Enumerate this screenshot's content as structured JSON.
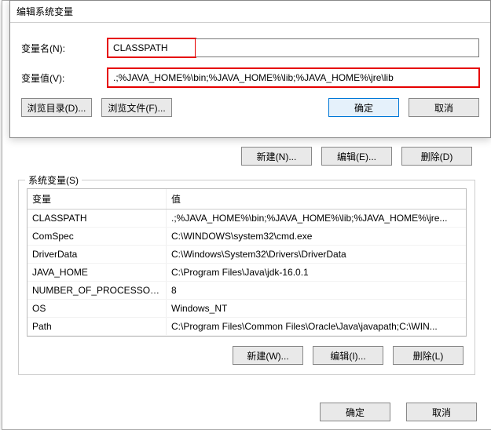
{
  "edit_dialog": {
    "title": "编辑系统变量",
    "name_label": "变量名(N):",
    "name_value": "CLASSPATH",
    "value_label": "变量值(V):",
    "value_value": ".;%JAVA_HOME%\\bin;%JAVA_HOME%\\lib;%JAVA_HOME%\\jre\\lib",
    "browse_dir": "浏览目录(D)...",
    "browse_file": "浏览文件(F)...",
    "ok": "确定",
    "cancel": "取消"
  },
  "mid_buttons": {
    "new": "新建(N)...",
    "edit": "编辑(E)...",
    "delete": "删除(D)"
  },
  "sysvars": {
    "group_label": "系统变量(S)",
    "header_var": "变量",
    "header_val": "值",
    "rows": [
      {
        "var": "CLASSPATH",
        "val": ".;%JAVA_HOME%\\bin;%JAVA_HOME%\\lib;%JAVA_HOME%\\jre..."
      },
      {
        "var": "ComSpec",
        "val": "C:\\WINDOWS\\system32\\cmd.exe"
      },
      {
        "var": "DriverData",
        "val": "C:\\Windows\\System32\\Drivers\\DriverData"
      },
      {
        "var": "JAVA_HOME",
        "val": "C:\\Program Files\\Java\\jdk-16.0.1"
      },
      {
        "var": "NUMBER_OF_PROCESSORS",
        "val": "8"
      },
      {
        "var": "OS",
        "val": "Windows_NT"
      },
      {
        "var": "Path",
        "val": "C:\\Program Files\\Common Files\\Oracle\\Java\\javapath;C:\\WIN..."
      }
    ],
    "new": "新建(W)...",
    "edit": "编辑(I)...",
    "delete": "删除(L)"
  },
  "footer": {
    "ok": "确定",
    "cancel": "取消"
  }
}
